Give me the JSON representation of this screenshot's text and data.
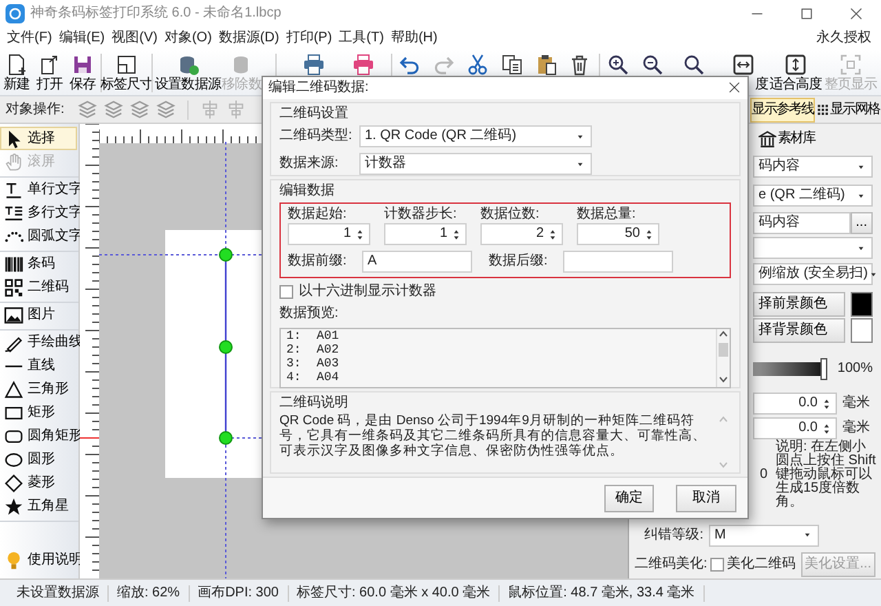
{
  "window": {
    "title": "神奇条码标签打印系统 6.0 - 未命名1.lbcp"
  },
  "menu": {
    "items": [
      "文件(F)",
      "编辑(E)",
      "视图(V)",
      "对象(O)",
      "数据源(D)",
      "打印(P)",
      "工具(T)",
      "帮助(H)"
    ],
    "license": "永久授权"
  },
  "toolbar": [
    {
      "kind": "new",
      "label": "新建",
      "disabled": false
    },
    {
      "kind": "open",
      "label": "打开",
      "disabled": false
    },
    {
      "kind": "save",
      "label": "保存",
      "disabled": false
    },
    {
      "kind": "size",
      "label": "标签尺寸",
      "disabled": false
    },
    {
      "kind": "datasource",
      "label": "设置数据源",
      "disabled": false
    },
    {
      "kind": "remove",
      "label": "移除数",
      "disabled": true
    },
    {
      "kind": "preview",
      "disabled": false
    },
    {
      "kind": "print",
      "disabled": false
    },
    {
      "kind": "undo",
      "disabled": false
    },
    {
      "kind": "redo",
      "disabled": true
    },
    {
      "kind": "cut",
      "disabled": false
    },
    {
      "kind": "copy",
      "disabled": false
    },
    {
      "kind": "paste",
      "disabled": false
    },
    {
      "kind": "delete",
      "disabled": false
    },
    {
      "kind": "zoom_in",
      "disabled": false
    },
    {
      "kind": "zoom_out",
      "disabled": false
    },
    {
      "kind": "zoom",
      "disabled": false
    },
    {
      "kind": "fit_width",
      "label": "度",
      "disabled": false
    },
    {
      "kind": "fit_height",
      "label": "适合高度",
      "disabled": false
    },
    {
      "kind": "fit_page",
      "label": "整页显示",
      "disabled": true
    }
  ],
  "object_bar": {
    "label": "对象操作:"
  },
  "view_toggles": [
    {
      "kind": "guides",
      "label": "显示参考线",
      "selected": true
    },
    {
      "kind": "grid",
      "label": "显示网格",
      "selected": false
    }
  ],
  "sidebar": {
    "items": [
      {
        "kind": "select",
        "label": "选择",
        "selected": true,
        "disabled": false
      },
      {
        "kind": "pan",
        "label": "滚屏",
        "selected": false,
        "disabled": true
      },
      {
        "kind": "text",
        "label": "单行文字",
        "selected": false,
        "disabled": false
      },
      {
        "kind": "mtext",
        "label": "多行文字",
        "selected": false,
        "disabled": false
      },
      {
        "kind": "arctext",
        "label": "圆弧文字",
        "selected": false,
        "disabled": false
      },
      {
        "kind": "barcode",
        "label": "条码",
        "selected": false,
        "disabled": false
      },
      {
        "kind": "qrcode",
        "label": "二维码",
        "selected": false,
        "disabled": false
      },
      {
        "kind": "image",
        "label": "图片",
        "selected": false,
        "disabled": false
      },
      {
        "kind": "freehand",
        "label": "手绘曲线",
        "selected": false,
        "disabled": false
      },
      {
        "kind": "line",
        "label": "直线",
        "selected": false,
        "disabled": false
      },
      {
        "kind": "triangle",
        "label": "三角形",
        "selected": false,
        "disabled": false
      },
      {
        "kind": "rect",
        "label": "矩形",
        "selected": false,
        "disabled": false
      },
      {
        "kind": "roundrect",
        "label": "圆角矩形",
        "selected": false,
        "disabled": false
      },
      {
        "kind": "ellipse",
        "label": "圆形",
        "selected": false,
        "disabled": false
      },
      {
        "kind": "diamond",
        "label": "菱形",
        "selected": false,
        "disabled": false
      },
      {
        "kind": "star",
        "label": "五角星",
        "selected": false,
        "disabled": false
      }
    ],
    "help": "使用说明"
  },
  "right_panel": {
    "tab": "素材库",
    "rows": [
      {
        "kind": "select",
        "value": "码内容"
      },
      {
        "kind": "select",
        "value": "e (QR 二维码)"
      },
      {
        "kind": "browse",
        "value": "码内容",
        "button": "..."
      },
      {
        "kind": "select"
      },
      {
        "kind": "select",
        "value": "例缩放 (安全易扫)"
      },
      {
        "kind": "color",
        "label": "择前景颜色",
        "color": "#000000"
      },
      {
        "kind": "color",
        "label": "择背景颜色",
        "color": "#ffffff"
      },
      {
        "kind": "slider",
        "level": 1,
        "reading": "100%"
      },
      {
        "kind": "number",
        "value": "0.0",
        "unit": "毫米"
      },
      {
        "kind": "number",
        "value": "0.0",
        "unit": "毫米"
      },
      {
        "kind": "note",
        "value": "0",
        "text": "说明: 在左侧小圆点上按住 Shift 键拖动鼠标可以生成15度倍数角。"
      }
    ],
    "error_level": {
      "label": "纠错等级:",
      "value": "M"
    },
    "beautify": {
      "label": "二维码美化:",
      "checkbox": "美化二维码",
      "checked": false,
      "button": "美化设置...",
      "disabled": true
    }
  },
  "dialog": {
    "title": "编辑二维码数据:",
    "settings": {
      "title": "二维码设置",
      "fields": [
        {
          "label": "二维码类型:",
          "value": "1. QR Code (QR 二维码)"
        },
        {
          "label": "数据来源:",
          "value": "计数器"
        }
      ]
    },
    "edit": {
      "title": "编辑数据",
      "spinners": [
        {
          "label": "数据起始:",
          "value": "1"
        },
        {
          "label": "计数器步长:",
          "value": "1"
        },
        {
          "label": "数据位数:",
          "value": "2"
        },
        {
          "label": "数据总量:",
          "value": "50"
        }
      ],
      "prefix": {
        "label": "数据前缀:",
        "value": "A"
      },
      "suffix": {
        "label": "数据后缀:"
      },
      "hex_checkbox": {
        "label": "以十六进制显示计数器",
        "checked": false
      },
      "preview": {
        "label": "数据预览:",
        "lines": [
          {
            "index": "1:",
            "value": "A01"
          },
          {
            "index": "2:",
            "value": "A02"
          },
          {
            "index": "3:",
            "value": "A03"
          },
          {
            "index": "4:",
            "value": "A04"
          }
        ]
      }
    },
    "description": {
      "title": "二维码说明",
      "text": "QR Code 码，是由 Denso 公司于1994年9月研制的一种矩阵二维码符号，它具有一维条码及其它二维条码所具有的信息容量大、可靠性高、可表示汉字及图像多种文字信息、保密防伪性强等优点。"
    },
    "buttons": [
      "确定",
      "取消"
    ]
  },
  "status_bar": [
    "未设置数据源",
    "缩放: 62%",
    "画布DPI: 300",
    "标签尺寸: 60.0 毫米 x 40.0 毫米",
    "鼠标位置: 48.7 毫米, 33.4 毫米"
  ]
}
